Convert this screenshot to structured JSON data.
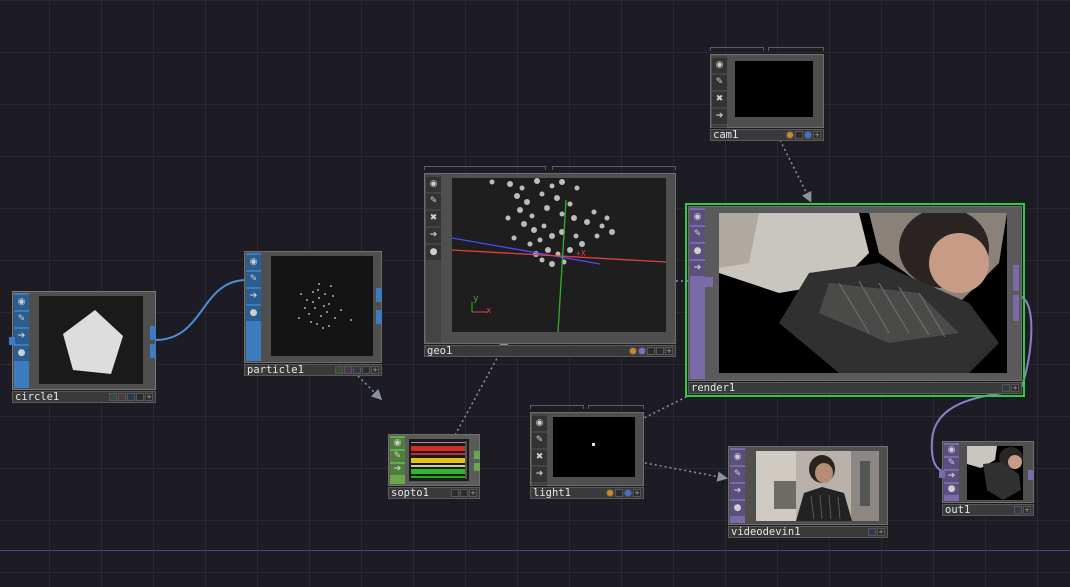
{
  "network": {
    "nodes": {
      "circle1": {
        "label": "circle1",
        "family": "SOP",
        "color": "#3d7dbf"
      },
      "particle1": {
        "label": "particle1",
        "family": "SOP",
        "color": "#3d7dbf"
      },
      "geo1": {
        "label": "geo1",
        "family": "COMP",
        "color": "#5a5a5a"
      },
      "cam1": {
        "label": "cam1",
        "family": "COMP",
        "color": "#5a5a5a"
      },
      "render1": {
        "label": "render1",
        "family": "TOP",
        "color": "#7a6aa8",
        "selected": true
      },
      "sopto1": {
        "label": "sopto1",
        "family": "DAT",
        "color": "#6aa84f"
      },
      "light1": {
        "label": "light1",
        "family": "COMP",
        "color": "#5a5a5a"
      },
      "videodevin1": {
        "label": "videodevin1",
        "family": "TOP",
        "color": "#7a6aa8"
      },
      "out1": {
        "label": "out1",
        "family": "TOP",
        "color": "#7a6aa8"
      }
    },
    "viewer_axes": {
      "y": "y",
      "x": "x"
    },
    "connections": [
      [
        "circle1",
        "particle1"
      ],
      [
        "particle1",
        "sopto1"
      ],
      [
        "sopto1",
        "geo1"
      ],
      [
        "cam1",
        "render1"
      ],
      [
        "geo1",
        "render1"
      ],
      [
        "light1",
        "render1"
      ],
      [
        "light1",
        "videodevin1"
      ],
      [
        "render1",
        "out1"
      ]
    ]
  },
  "colors": {
    "background": "#1d1c24",
    "sop": "#3d7dbf",
    "top": "#7a6aa8",
    "dat": "#6aa84f",
    "selected_outline": "#2ecc40",
    "wire_sop": "#4a90d9",
    "wire_top": "#8b7fc8",
    "wire_comp": "#8a8f9a"
  }
}
